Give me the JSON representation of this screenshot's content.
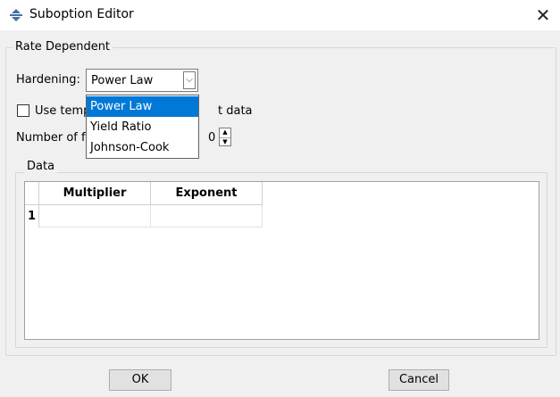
{
  "window": {
    "title": "Suboption Editor",
    "close_glyph": "✕"
  },
  "group": {
    "title": "Rate Dependent"
  },
  "hardening": {
    "label": "Hardening:",
    "selected": "Power Law",
    "arrow_glyph": "⌵",
    "options": [
      "Power Law",
      "Yield Ratio",
      "Johnson-Cook"
    ],
    "highlighted_index": 0
  },
  "temperature_checkbox": {
    "label_visible": "Use temp",
    "label_tail": "t data",
    "checked": false
  },
  "field_variables": {
    "label_visible": "Number of f",
    "value": "0",
    "up_glyph": "▲",
    "down_glyph": "▼"
  },
  "data": {
    "title": "Data",
    "columns": [
      "Multiplier",
      "Exponent"
    ],
    "rows": [
      {
        "index": "1",
        "cells": [
          "",
          ""
        ]
      }
    ]
  },
  "buttons": {
    "ok": "OK",
    "cancel": "Cancel"
  },
  "colors": {
    "selection": "#0078d7",
    "dialog_bg": "#f0f0f0"
  }
}
